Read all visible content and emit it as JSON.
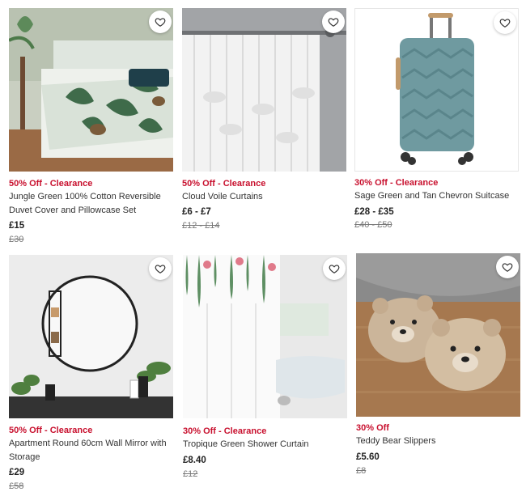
{
  "products": [
    {
      "badge": "50% Off - Clearance",
      "title": "Jungle Green 100% Cotton Reversible Duvet Cover and Pillowcase Set",
      "price": "£15",
      "was_price": "£30",
      "image": "jungle-bedding-image"
    },
    {
      "badge": "50% Off - Clearance",
      "title": "Cloud Voile Curtains",
      "price": "£6 - £7",
      "was_price": "£12 - £14",
      "image": "voile-curtain-image"
    },
    {
      "badge": "30% Off - Clearance",
      "title": "Sage Green and Tan Chevron Suitcase",
      "price": "£28 - £35",
      "was_price": "£40 - £50",
      "image": "suitcase-image"
    },
    {
      "badge": "50% Off - Clearance",
      "title": "Apartment Round 60cm Wall Mirror with Storage",
      "price": "£29",
      "was_price": "£58",
      "image": "round-mirror-image"
    },
    {
      "badge": "30% Off - Clearance",
      "title": "Tropique Green Shower Curtain",
      "price": "£8.40",
      "was_price": "£12",
      "image": "shower-curtain-image"
    },
    {
      "badge": "30% Off",
      "title": "Teddy Bear Slippers",
      "price": "£5.60",
      "was_price": "£8",
      "image": "teddy-slippers-image"
    }
  ],
  "icons": {
    "wishlist": "heart-outline-icon"
  },
  "colors": {
    "sale_red": "#c8102e",
    "text": "#333333",
    "was_price": "#777777"
  }
}
